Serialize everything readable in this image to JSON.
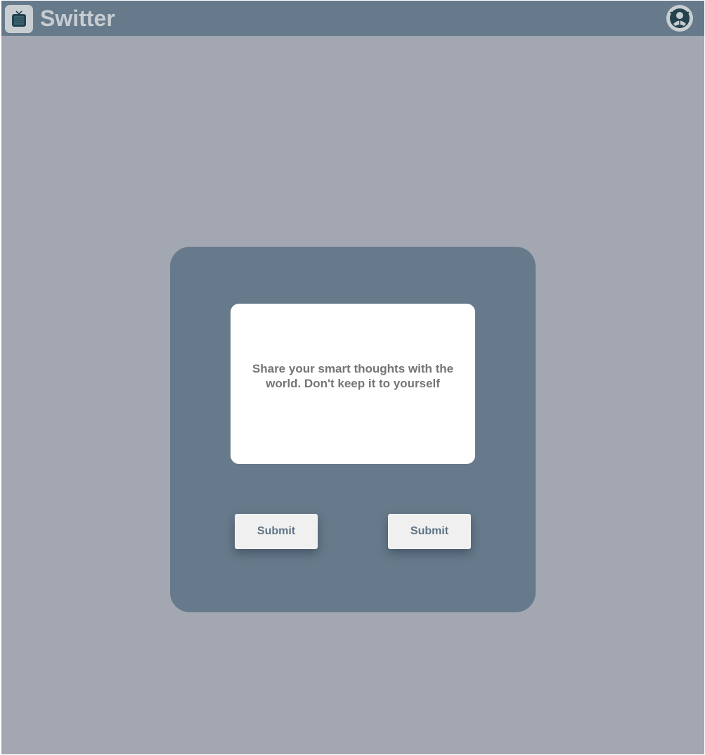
{
  "header": {
    "app_title": "Switter",
    "logo_icon": "tv-icon",
    "profile_icon": "user-profile-icon",
    "background_color": "#667a8b"
  },
  "composer": {
    "prompt_text": "Share your smart thoughts with the world. Don't keep it to yourself",
    "buttons": [
      {
        "label": "Submit"
      },
      {
        "label": "Submit"
      }
    ]
  },
  "colors": {
    "page_background": "#a3a7b2",
    "card_background": "#667a8b",
    "button_text": "#5e7385",
    "prompt_text": "#757575"
  }
}
